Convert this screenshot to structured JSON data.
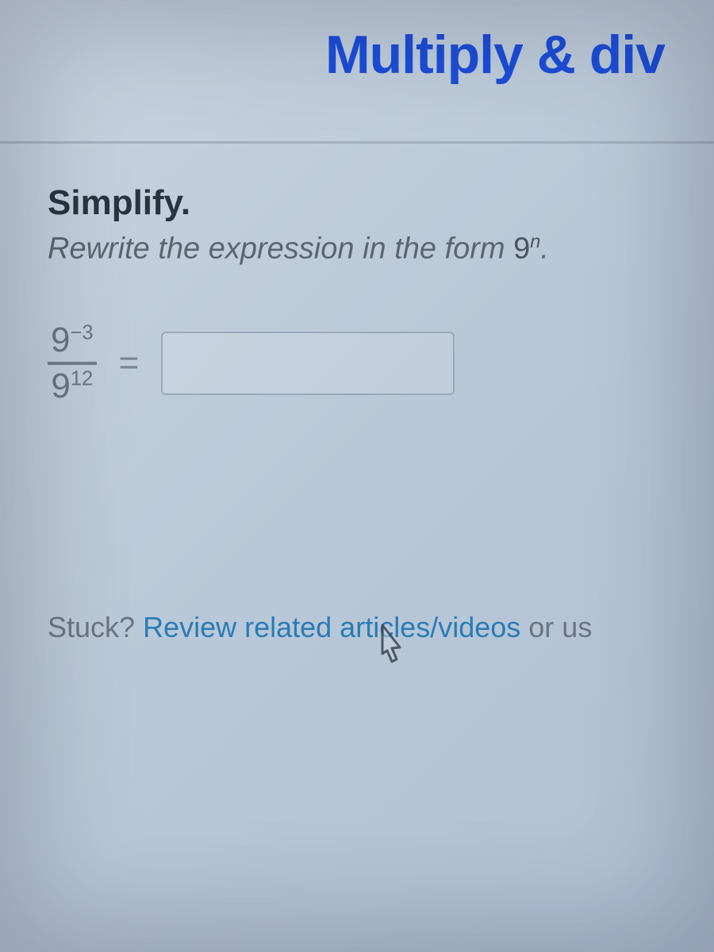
{
  "header": {
    "title": "Multiply & div"
  },
  "problem": {
    "simplify_label": "Simplify.",
    "instruction_text": "Rewrite the expression in the form ",
    "instruction_base": "9",
    "instruction_exponent": "n",
    "instruction_suffix": ".",
    "fraction": {
      "num_base": "9",
      "num_exp": "−3",
      "den_base": "9",
      "den_exp": "12"
    },
    "equals": "=",
    "answer_value": ""
  },
  "stuck": {
    "prefix": "Stuck? ",
    "link_text": "Review related articles/videos",
    "suffix": " or us"
  }
}
